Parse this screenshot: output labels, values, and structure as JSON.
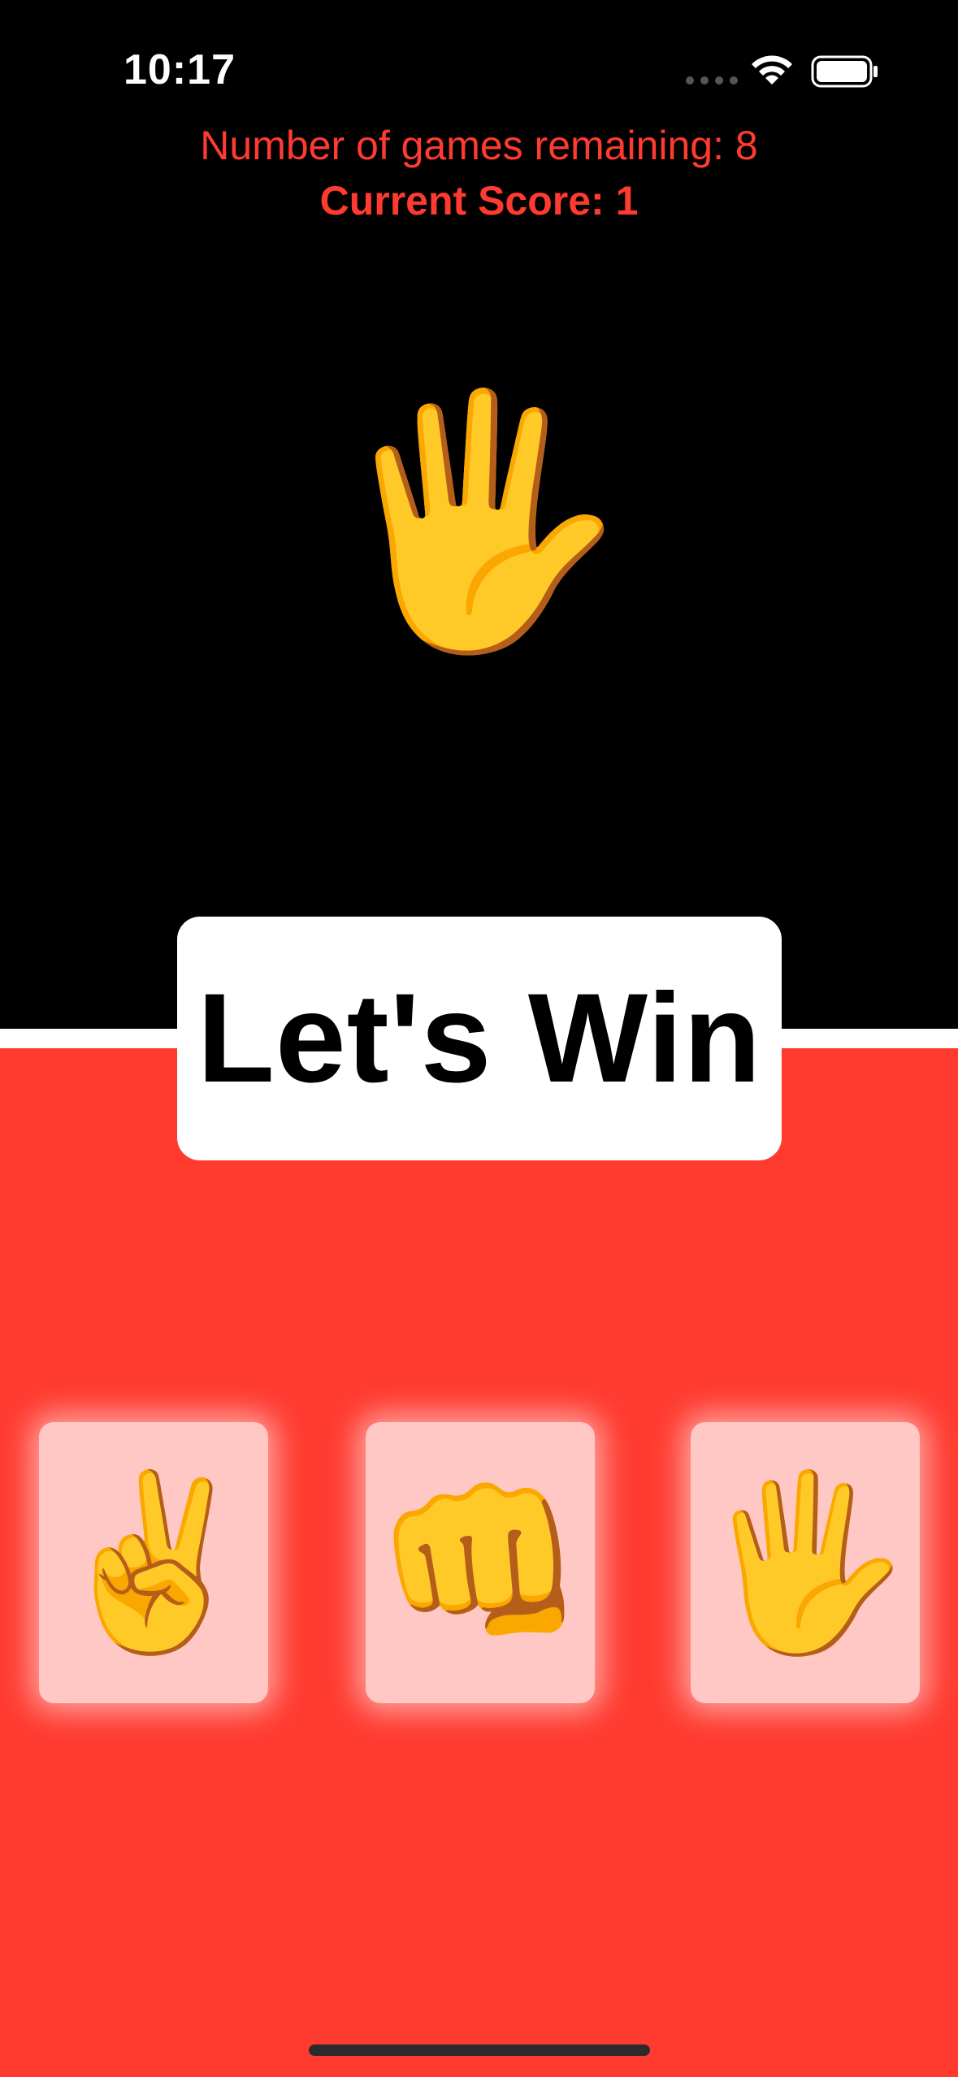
{
  "status_bar": {
    "time": "10:17"
  },
  "header": {
    "games_remaining": "Number of games remaining: 8",
    "current_score": "Current Score: 1"
  },
  "computer_choice": {
    "emoji": "🖐"
  },
  "prompt": {
    "text": "Let's Win"
  },
  "choices": [
    {
      "name": "scissors",
      "emoji": "✌️"
    },
    {
      "name": "rock",
      "emoji": "👊"
    },
    {
      "name": "paper",
      "emoji": "🖐"
    }
  ],
  "colors": {
    "top_background": "#000000",
    "bottom_background": "#ff3b30",
    "accent_text": "#ff3b30"
  },
  "icons": [
    "wifi-icon",
    "battery-icon"
  ]
}
